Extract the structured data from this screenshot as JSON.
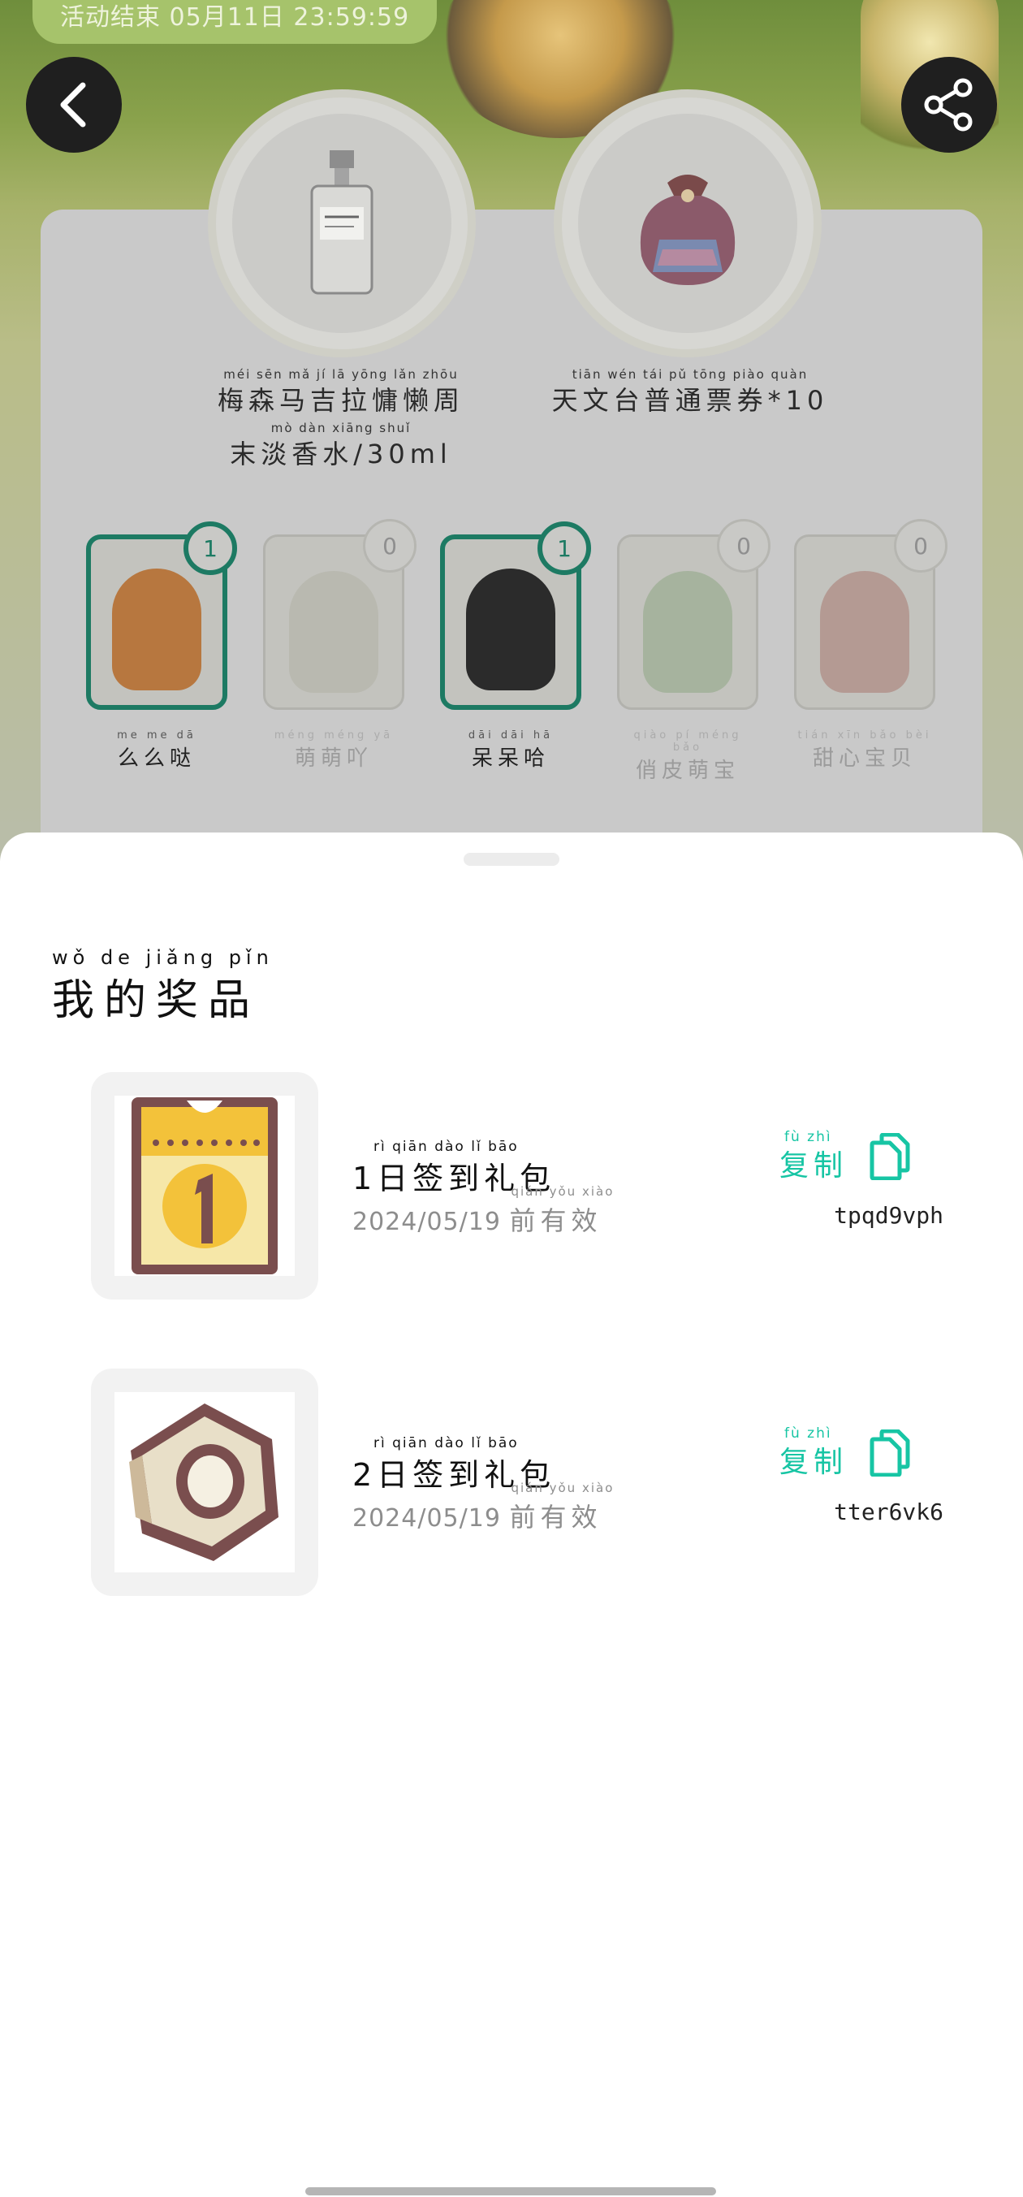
{
  "event": {
    "end_time": "活动结束 05月11日 23:59:59"
  },
  "header": {
    "back_icon": "chevron-left-icon",
    "share_icon": "share-icon"
  },
  "prizes": [
    {
      "pinyin": "méi sēn mǎ jí lā yōng lǎn zhōu",
      "name": "梅森马吉拉慵懒周",
      "pinyin2": "mò dàn xiāng shuǐ",
      "name2": "末淡香水/30ml"
    },
    {
      "pinyin": "tiān wén tái pǔ tōng piào quàn",
      "name": "天文台普通票券*10"
    }
  ],
  "characters": [
    {
      "pinyin": "me me dā",
      "name": "么么哒",
      "count": "1",
      "owned": true,
      "color": "#b7773f"
    },
    {
      "pinyin": "méng méng yā",
      "name": "萌萌吖",
      "count": "0",
      "owned": false,
      "color": "#b9b9b0"
    },
    {
      "pinyin": "dāi dāi hā",
      "name": "呆呆哈",
      "count": "1",
      "owned": true,
      "color": "#2b2b2b"
    },
    {
      "pinyin": "qiào pí méng bǎo",
      "name": "俏皮萌宝",
      "count": "0",
      "owned": false,
      "color": "#a6b39e"
    },
    {
      "pinyin": "tián xīn bǎo bèi",
      "name": "甜心宝贝",
      "count": "0",
      "owned": false,
      "color": "#b49a93"
    }
  ],
  "sheet": {
    "title_pinyin": "wǒ de jiǎng pǐn",
    "title": "我的奖品",
    "items": [
      {
        "icon": "calendar-day-1-icon",
        "name_pinyin": "rì qiān dào lǐ bāo",
        "name": "1日签到礼包",
        "expiry_date": "2024/05/19",
        "expiry_pinyin": "qián yǒu xiào",
        "expiry_suffix": "前有效",
        "copy_pinyin": "fù zhì",
        "copy_label": "复制",
        "code": "tpqd9vph"
      },
      {
        "icon": "hex-nut-icon",
        "name_pinyin": "rì qiān dào lǐ bāo",
        "name": "2日签到礼包",
        "expiry_date": "2024/05/19",
        "expiry_pinyin": "qián yǒu xiào",
        "expiry_suffix": "前有效",
        "copy_pinyin": "fù zhì",
        "copy_label": "复制",
        "code": "tter6vk6"
      }
    ]
  },
  "colors": {
    "accent": "#17c5a4",
    "owned_border": "#1d7a63"
  }
}
